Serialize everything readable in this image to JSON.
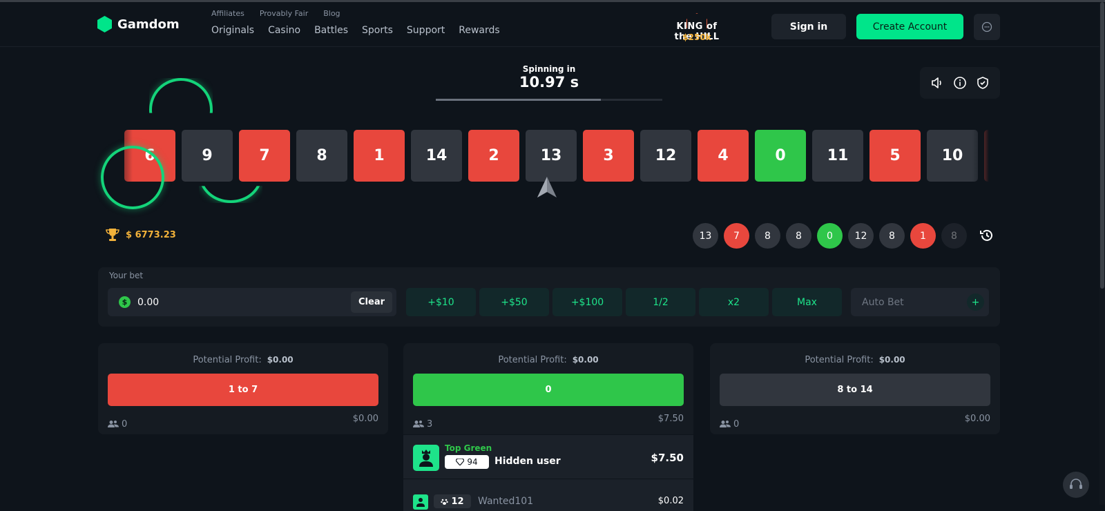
{
  "brand": {
    "name": "Gamdom"
  },
  "subnav": [
    "Affiliates",
    "Provably Fair",
    "Blog"
  ],
  "nav": [
    "Originals",
    "Casino",
    "Battles",
    "Sports",
    "Support",
    "Rewards"
  ],
  "promo": {
    "title": "KING of the HILL",
    "prize": "$250k"
  },
  "auth": {
    "signin": "Sign in",
    "create": "Create Account"
  },
  "timer": {
    "label": "Spinning in",
    "value": "10.97 s",
    "progress": 0.73
  },
  "reel": [
    {
      "n": "6",
      "c": "red"
    },
    {
      "n": "9",
      "c": "dark"
    },
    {
      "n": "7",
      "c": "red"
    },
    {
      "n": "8",
      "c": "dark"
    },
    {
      "n": "1",
      "c": "red"
    },
    {
      "n": "14",
      "c": "dark"
    },
    {
      "n": "2",
      "c": "red"
    },
    {
      "n": "13",
      "c": "dark"
    },
    {
      "n": "3",
      "c": "red"
    },
    {
      "n": "12",
      "c": "dark"
    },
    {
      "n": "4",
      "c": "red"
    },
    {
      "n": "0",
      "c": "green"
    },
    {
      "n": "11",
      "c": "dark"
    },
    {
      "n": "5",
      "c": "red"
    },
    {
      "n": "10",
      "c": "dark"
    },
    {
      "n": "",
      "c": "red"
    }
  ],
  "jackpot": {
    "value": "$ 6773.23"
  },
  "last_rolls": [
    {
      "n": "13",
      "c": "dark"
    },
    {
      "n": "7",
      "c": "red"
    },
    {
      "n": "8",
      "c": "dark"
    },
    {
      "n": "8",
      "c": "dark"
    },
    {
      "n": "0",
      "c": "green"
    },
    {
      "n": "12",
      "c": "dark"
    },
    {
      "n": "8",
      "c": "dark"
    },
    {
      "n": "1",
      "c": "red"
    },
    {
      "n": "8",
      "c": "dark",
      "faded": true
    }
  ],
  "bet": {
    "label": "Your bet",
    "value": "0.00",
    "currency_symbol": "$",
    "clear": "Clear",
    "modifiers": [
      "+$10",
      "+$50",
      "+$100",
      "1/2",
      "x2",
      "Max"
    ],
    "autobet": "Auto Bet",
    "autobet_plus": "+"
  },
  "columns": [
    {
      "profit_label": "Potential Profit:",
      "profit": "$0.00",
      "button": "1 to 7",
      "color": "red",
      "players": "0",
      "total": "$0.00"
    },
    {
      "profit_label": "Potential Profit:",
      "profit": "$0.00",
      "button": "0",
      "color": "green",
      "players": "3",
      "total": "$7.50"
    },
    {
      "profit_label": "Potential Profit:",
      "profit": "$0.00",
      "button": "8 to 14",
      "color": "dark",
      "players": "0",
      "total": "$0.00"
    }
  ],
  "green_players": [
    {
      "tag": "Top Green",
      "level": "94",
      "name": "Hidden user",
      "amount": "$7.50"
    },
    {
      "tag": "",
      "level": "12",
      "name": "Wanted101",
      "amount": "$0.02"
    }
  ],
  "colors": {
    "accent": "#00e58a",
    "red": "#e8473d",
    "green": "#2fc64a",
    "dark": "#31363e",
    "gold": "#f2b23a"
  }
}
